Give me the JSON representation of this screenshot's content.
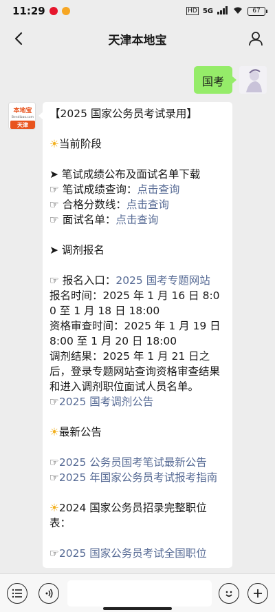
{
  "status": {
    "time": "11:29",
    "network": "5G",
    "battery": "67"
  },
  "nav": {
    "title": "天津本地宝"
  },
  "messages": {
    "sent": "国考",
    "brand_logo_text": "本地宝",
    "brand_logo_sub": "Bendibao.com",
    "brand_city": "天津",
    "lines": [
      {
        "t": "【2025 国家公务员考试录用】",
        "k": "text"
      },
      {
        "t": "",
        "k": "blank"
      },
      {
        "t": "当前阶段",
        "k": "sun"
      },
      {
        "t": "",
        "k": "blank"
      },
      {
        "t": "➤ 笔试成绩公布及面试名单下载",
        "k": "text"
      },
      {
        "t": "☞ 笔试成绩查询：",
        "link": "点击查询",
        "k": "mixed"
      },
      {
        "t": "☞ 合格分数线：",
        "link": "点击查询",
        "k": "mixed"
      },
      {
        "t": "☞ 面试名单：",
        "link": "点击查询",
        "k": "mixed"
      },
      {
        "t": "",
        "k": "blank"
      },
      {
        "t": "➤ 调剂报名",
        "k": "text"
      },
      {
        "t": "",
        "k": "blank"
      },
      {
        "t": "☞ 报名入口：",
        "link": "2025 国考专题网站",
        "k": "mixed"
      },
      {
        "t": "报名时间：2025 年 1 月 16 日 8:00 至 1 月 18 日 18:00",
        "k": "text"
      },
      {
        "t": "资格审查时间：2025 年 1 月 19 日 8:00 至 1 月 20 日 18:00",
        "k": "text"
      },
      {
        "t": "调剂结果：2025 年 1 月 21 日之后，登录专题网站查询资格审查结果和进入调剂职位面试人员名单。",
        "k": "text"
      },
      {
        "t": "☞",
        "link": "2025 国考调剂公告",
        "k": "mixed"
      },
      {
        "t": "",
        "k": "blank"
      },
      {
        "t": "最新公告",
        "k": "sun"
      },
      {
        "t": "",
        "k": "blank"
      },
      {
        "t": "☞",
        "link": "2025 公务员国考笔试最新公告",
        "k": "mixed"
      },
      {
        "t": "☞",
        "link": "2025 年国家公务员考试报考指南",
        "k": "mixed"
      },
      {
        "t": "",
        "k": "blank"
      },
      {
        "t": "2024 国家公务员招录完整职位表：",
        "k": "sun"
      },
      {
        "t": "",
        "k": "blank"
      },
      {
        "t": "☞",
        "link": "2025 国家公务员考试全国职位",
        "k": "mixed"
      }
    ]
  },
  "colors": {
    "link": "#576b95",
    "sent_bubble": "#95ec69",
    "background": "#ededed"
  },
  "icons": {
    "back": "chevron-left-icon",
    "profile": "person-icon",
    "menu": "menu-icon",
    "voice": "voice-icon",
    "emoji": "emoji-icon",
    "plus": "plus-icon"
  }
}
